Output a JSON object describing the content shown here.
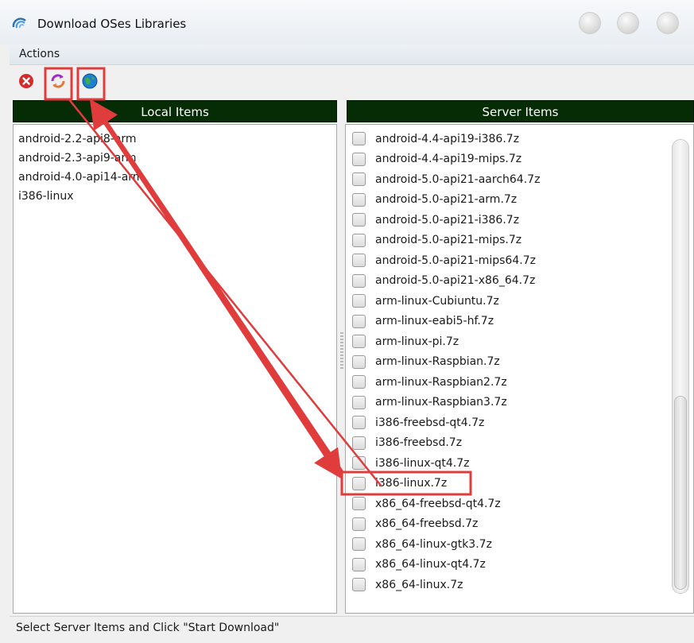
{
  "window": {
    "title": "Download OSes Libraries",
    "title_icon": "spiral-app-icon",
    "controls": [
      "minimize-icon",
      "maximize-icon",
      "close-icon"
    ]
  },
  "menubar": {
    "items": [
      {
        "label": "Actions"
      }
    ]
  },
  "toolbar": {
    "buttons": [
      {
        "icon": "stop-icon",
        "color": "#d62b2b"
      },
      {
        "icon": "refresh-icon",
        "color": "#9b2fc4"
      },
      {
        "icon": "globe-download-icon",
        "color": "#1f7fd1"
      }
    ]
  },
  "local_panel": {
    "header": "Local Items",
    "items": [
      "android-2.2-api8-arm",
      "android-2.3-api9-arm",
      "android-4.0-api14-arm",
      "i386-linux"
    ]
  },
  "server_panel": {
    "header": "Server Items",
    "items": [
      "android-4.4-api19-i386.7z",
      "android-4.4-api19-mips.7z",
      "android-5.0-api21-aarch64.7z",
      "android-5.0-api21-arm.7z",
      "android-5.0-api21-i386.7z",
      "android-5.0-api21-mips.7z",
      "android-5.0-api21-mips64.7z",
      "android-5.0-api21-x86_64.7z",
      "arm-linux-Cubiuntu.7z",
      "arm-linux-eabi5-hf.7z",
      "arm-linux-pi.7z",
      "arm-linux-Raspbian.7z",
      "arm-linux-Raspbian2.7z",
      "arm-linux-Raspbian3.7z",
      "i386-freebsd-qt4.7z",
      "i386-freebsd.7z",
      "i386-linux-qt4.7z",
      "i386-linux.7z",
      "x86_64-freebsd-qt4.7z",
      "x86_64-freebsd.7z",
      "x86_64-linux-gtk3.7z",
      "x86_64-linux-qt4.7z",
      "x86_64-linux.7z"
    ],
    "highlighted_item": "i386-linux.7z"
  },
  "statusbar": {
    "text": "Select Server Items and Click \"Start Download\""
  },
  "colors": {
    "panel_header_bg": "#062c06",
    "annotation_red": "#e03c3c"
  }
}
